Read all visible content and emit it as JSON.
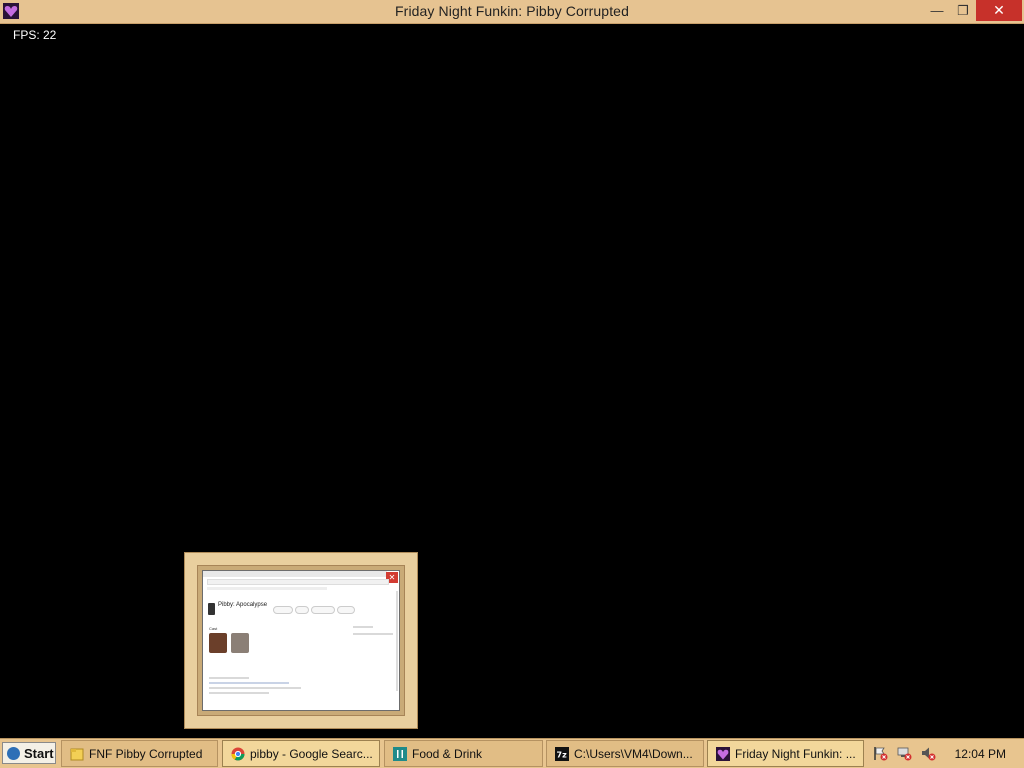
{
  "window": {
    "title": "Friday Night Funkin: Pibby Corrupted",
    "minimize_glyph": "—",
    "maximize_glyph": "❐",
    "close_glyph": "✕"
  },
  "game": {
    "fps_text": "FPS: 22"
  },
  "thumbnail": {
    "page_title": "Pibby: Apocalypse",
    "section_label": "Cast"
  },
  "taskbar": {
    "start_label": "Start",
    "items": [
      {
        "label": "FNF Pibby Corrupted",
        "icon": "folder-icon"
      },
      {
        "label": "pibby - Google Searc...",
        "icon": "chrome-icon"
      },
      {
        "label": "Food & Drink",
        "icon": "food-drink-app-icon"
      },
      {
        "label": "C:\\Users\\VM4\\Down...",
        "icon": "7zip-icon"
      },
      {
        "label": "Friday Night Funkin: ...",
        "icon": "fnf-heart-icon"
      }
    ],
    "clock": "12:04 PM"
  },
  "colors": {
    "titlebar": "#e6c391",
    "taskbar": "#e8c58f",
    "close_button": "#c7312a",
    "background": "#000000"
  }
}
